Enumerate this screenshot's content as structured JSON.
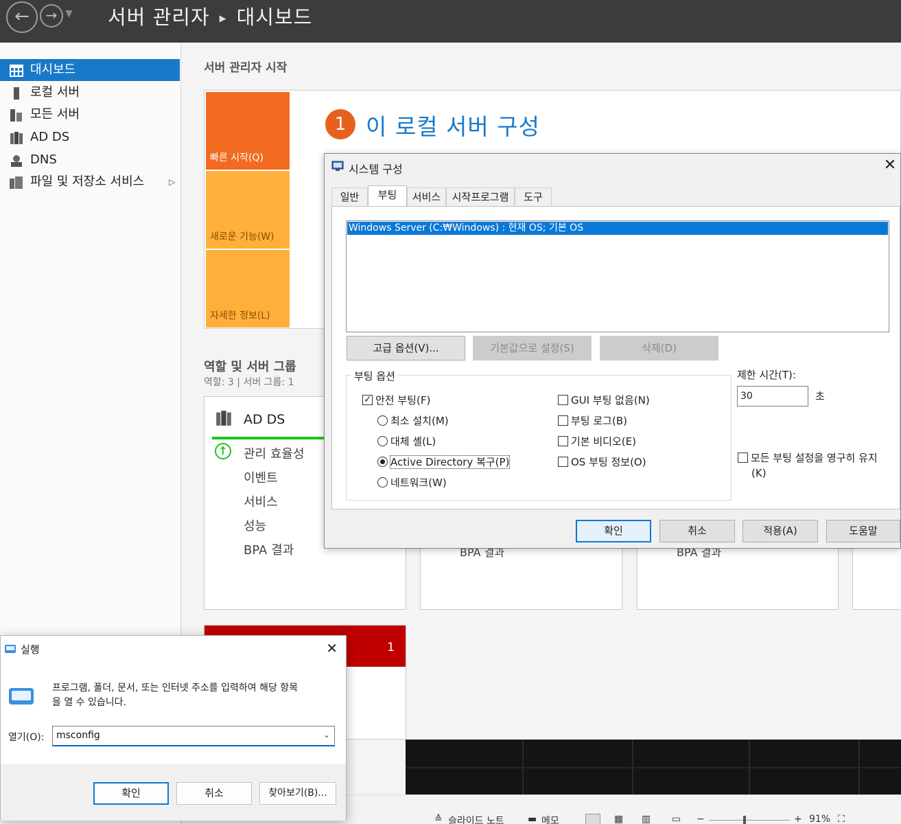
{
  "app": {
    "title": "서버 관리자",
    "page": "대시보드"
  },
  "sidebar": {
    "items": [
      {
        "label": "대시보드",
        "icon": "dashboard-icon"
      },
      {
        "label": "로컬 서버",
        "icon": "server-icon"
      },
      {
        "label": "모든 서버",
        "icon": "servers-icon"
      },
      {
        "label": "AD DS",
        "icon": "ad-ds-icon"
      },
      {
        "label": "DNS",
        "icon": "dns-icon"
      },
      {
        "label": "파일 및 저장소 서비스",
        "icon": "storage-icon"
      }
    ]
  },
  "main": {
    "heading": "서버 관리자 시작",
    "step_number": "1",
    "step_title": "이 로컬 서버 구성",
    "tiles": [
      "빠른 시작(Q)",
      "새로운 기능(W)",
      "자세한 정보(L)"
    ],
    "roles_heading": "역할 및 서버 그룹",
    "roles_sub": "역할: 3  |  서버 그룹: 1",
    "card": {
      "title": "AD DS",
      "lines": [
        "관리 효율성",
        "이벤트",
        "서비스",
        "성능",
        "BPA 결과"
      ],
      "other_bpa": "BPA 결과",
      "badge": "1"
    }
  },
  "syscfg": {
    "title": "시스템 구성",
    "tabs": [
      "일반",
      "부팅",
      "서비스",
      "시작프로그램",
      "도구"
    ],
    "boot_entry": "Windows Server (C:₩Windows) : 현재 OS; 기본 OS",
    "buttons": {
      "advanced": "고급 옵션(V)...",
      "set_default": "기본값으로 설정(S)",
      "delete": "삭제(D)"
    },
    "boot_options_label": "부팅 옵션",
    "safe_boot": "안전 부팅(F)",
    "radios": [
      "최소 설치(M)",
      "대체 셸(L)",
      "Active Directory 복구(P)",
      "네트워크(W)"
    ],
    "right_checks": [
      "GUI 부팅 없음(N)",
      "부팅 로그(B)",
      "기본 비디오(E)",
      "OS 부팅 정보(O)"
    ],
    "timeout_label": "제한 시간(T):",
    "timeout_value": "30",
    "timeout_unit": "초",
    "persist_label_1": "모든 부팅 설정을 영구히 유지",
    "persist_label_2": "(K)",
    "footer": {
      "ok": "확인",
      "cancel": "취소",
      "apply": "적용(A)",
      "help": "도움말"
    }
  },
  "run": {
    "title": "실행",
    "desc_1": "프로그램, 폴더, 문서, 또는 인터넷 주소를 입력하여 해당 항목",
    "desc_2": "을 열 수 있습니다.",
    "open_label": "열기(O):",
    "input_value": "msconfig",
    "ok": "확인",
    "cancel": "취소",
    "browse": "찾아보기(B)..."
  },
  "statusbar": {
    "slide_note": "슬라이드 노트",
    "memo": "메모",
    "zoom": "91%"
  },
  "colors": {
    "accent": "#1979c9",
    "orange_tile": "#f26b21",
    "amber_tile": "#ffb03b",
    "green_bar": "#1cc41c",
    "red_badge": "#c00000"
  }
}
